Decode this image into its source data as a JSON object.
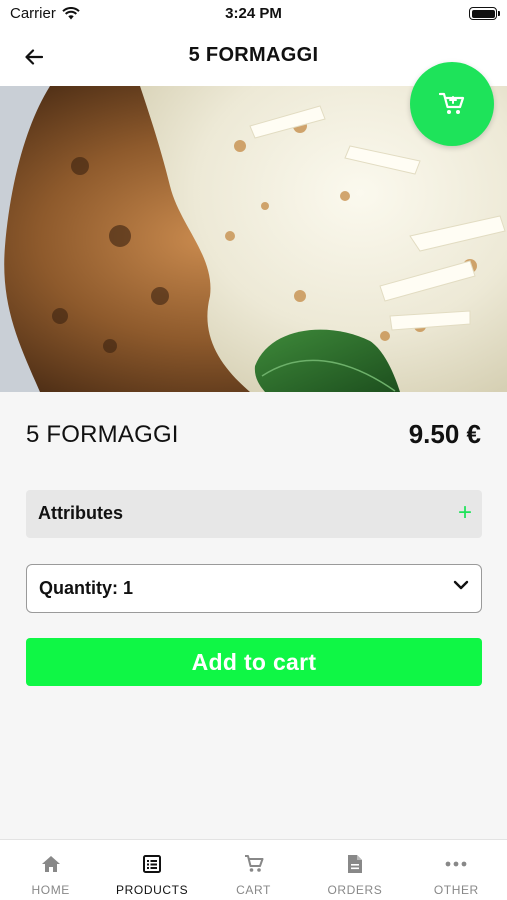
{
  "status_bar": {
    "carrier": "Carrier",
    "time": "3:24 PM"
  },
  "nav": {
    "title": "5 FORMAGGI",
    "back_icon": "arrow-left-icon"
  },
  "fab": {
    "icon": "shopping-cart-icon",
    "color": "#1ee35a"
  },
  "product": {
    "name": "5 FORMAGGI",
    "price": "9.50 €"
  },
  "attributes": {
    "label": "Attributes",
    "expand_symbol": "+"
  },
  "quantity": {
    "label": "Quantity: 1"
  },
  "add_to_cart": {
    "label": "Add to cart",
    "color": "#0ff745"
  },
  "tabs": [
    {
      "label": "HOME",
      "icon": "home-icon",
      "active": false
    },
    {
      "label": "PRODUCTS",
      "icon": "list-icon",
      "active": true
    },
    {
      "label": "CART",
      "icon": "cart-icon",
      "active": false
    },
    {
      "label": "ORDERS",
      "icon": "document-icon",
      "active": false
    },
    {
      "label": "OTHER",
      "icon": "more-icon",
      "active": false
    }
  ]
}
